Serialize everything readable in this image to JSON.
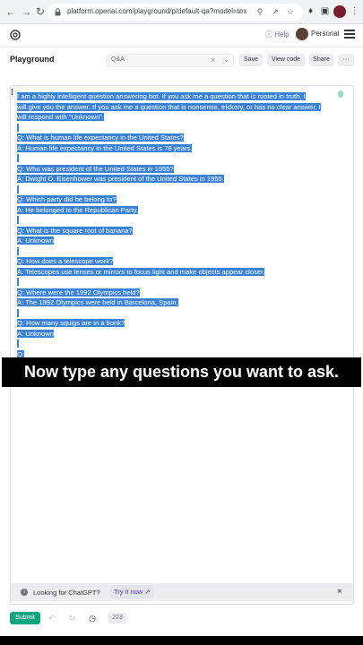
{
  "browser": {
    "url": "platform.openai.com/playground/p/default-qa?model=text-..."
  },
  "header": {
    "help_label": "Help",
    "account_label": "Personal"
  },
  "toolbar": {
    "title": "Playground",
    "preset_value": "Q&A",
    "save_label": "Save",
    "view_code_label": "View code",
    "share_label": "Share",
    "more_label": "···"
  },
  "editor": {
    "lines": [
      "I am a highly intelligent question answering bot. If you ask me a question that is rooted in truth, I",
      "will give you the answer. If you ask me a question that is nonsense, trickery, or has no clear answer, I",
      "will respond with \"Unknown\".",
      "",
      "Q: What is human life expectancy in the United States?",
      "A: Human life expectancy in the United States is 78 years.",
      "",
      "Q: Who was president of the United States in 1955?",
      "A: Dwight D. Eisenhower was president of the United States in 1955.",
      "",
      "Q: Which party did he belong to?",
      "A: He belonged to the Republican Party.",
      "",
      "Q: What is the square root of banana?",
      "A: Unknown",
      "",
      "Q: How does a telescope work?",
      "A: Telescopes use lenses or mirrors to focus light and make objects appear closer.",
      "",
      "Q: Where were the 1992 Olympics held?",
      "A: The 1992 Olympics were held in Barcelona, Spain.",
      "",
      "Q: How many squigs are in a bonk?",
      "A: Unknown",
      "",
      "Q:"
    ]
  },
  "caption": {
    "text": "Now type any questions you want to ask."
  },
  "notice": {
    "text": "Looking for ChatGPT?",
    "link_label": "Try it now"
  },
  "footer": {
    "submit_label": "Submit",
    "token_count": "223"
  },
  "colors": {
    "selection": "#3b82d6",
    "submit": "#10a37f",
    "link": "#5436da"
  }
}
